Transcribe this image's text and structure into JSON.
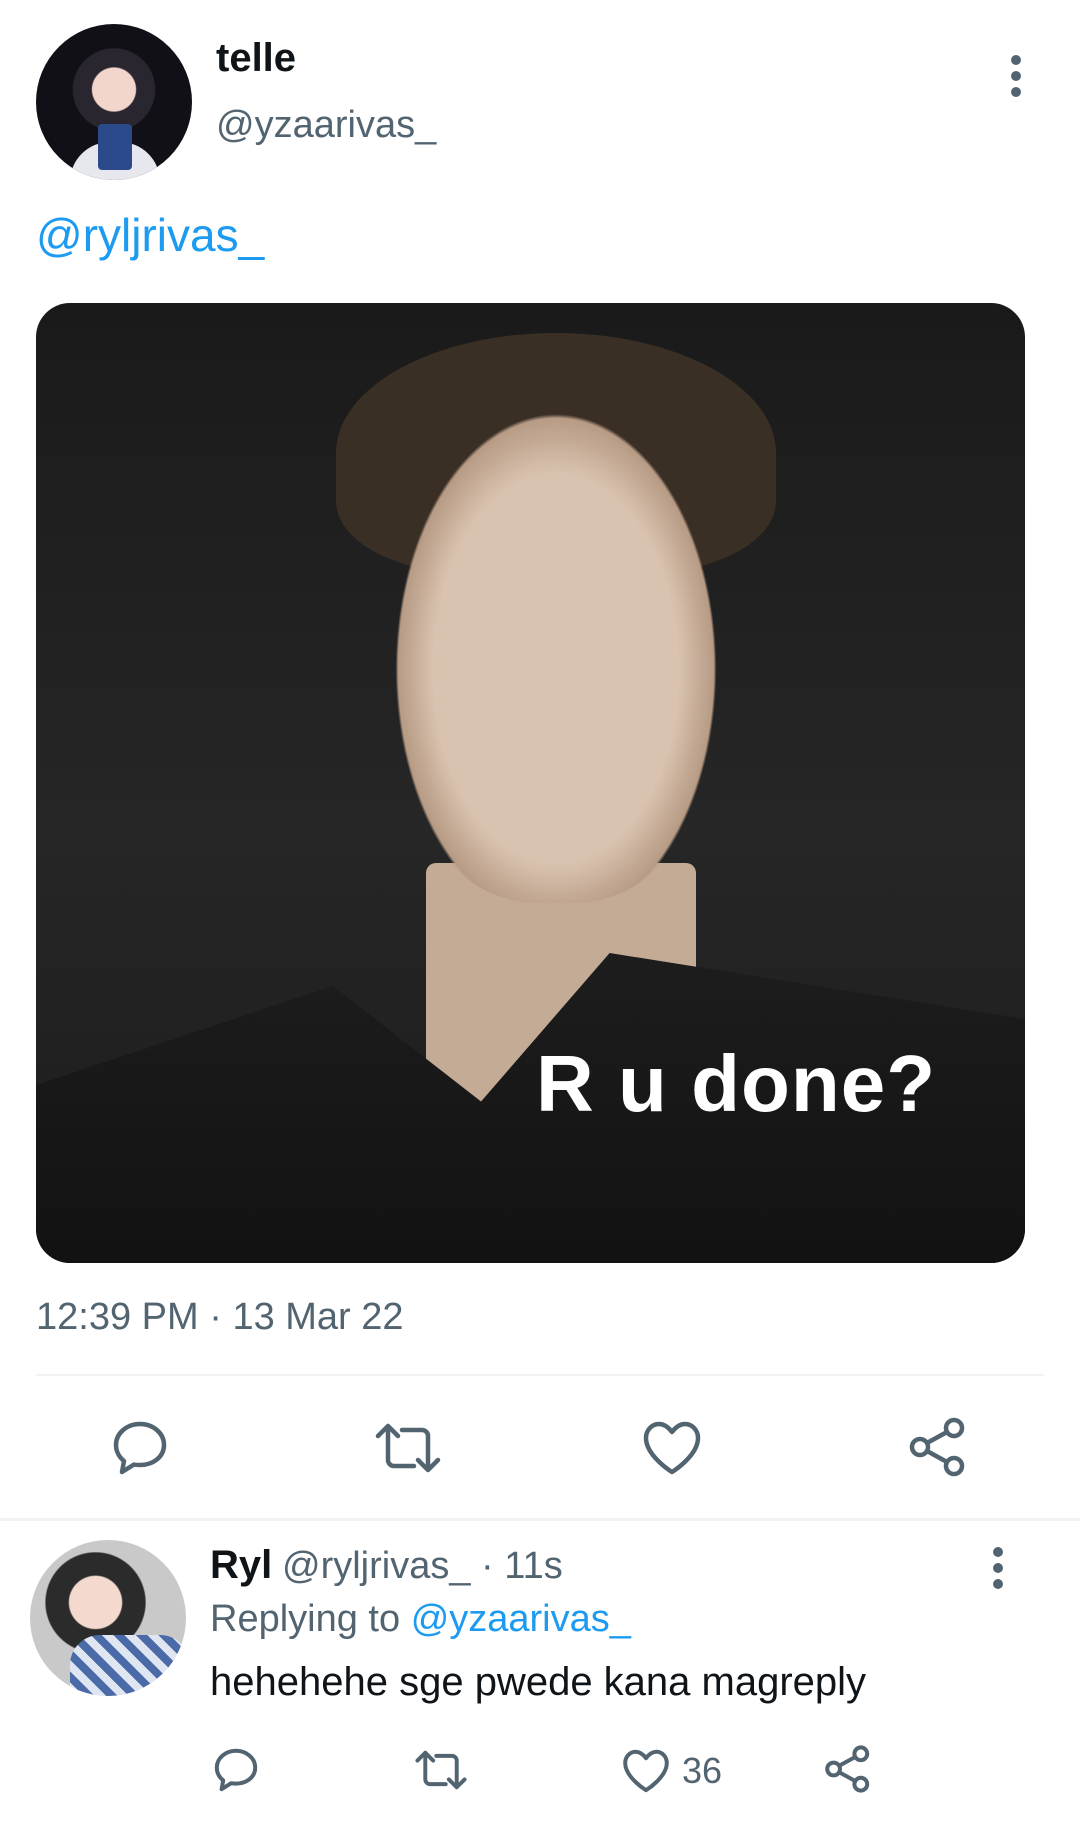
{
  "tweet": {
    "name": "telle",
    "handle": "@yzaarivas_",
    "mention": "@ryljrivas_",
    "media_caption": "R u done?",
    "time": "12:39 PM",
    "separator": "·",
    "date": "13 Mar 22"
  },
  "reply": {
    "name": "Ryl",
    "handle": "@ryljrivas_",
    "separator": "·",
    "age": "11s",
    "replying_prefix": "Replying to",
    "replying_to": "@yzaarivas_",
    "text": "hehehehe sge pwede kana magreply",
    "like_count": "36"
  },
  "icons": {
    "more": "more-vertical-icon",
    "reply": "reply-icon",
    "retweet": "retweet-icon",
    "like": "heart-icon",
    "share": "share-icon"
  },
  "colors": {
    "link": "#1d9bf0",
    "secondary": "#536471",
    "text": "#0f1419",
    "divider": "#eff3f4"
  }
}
